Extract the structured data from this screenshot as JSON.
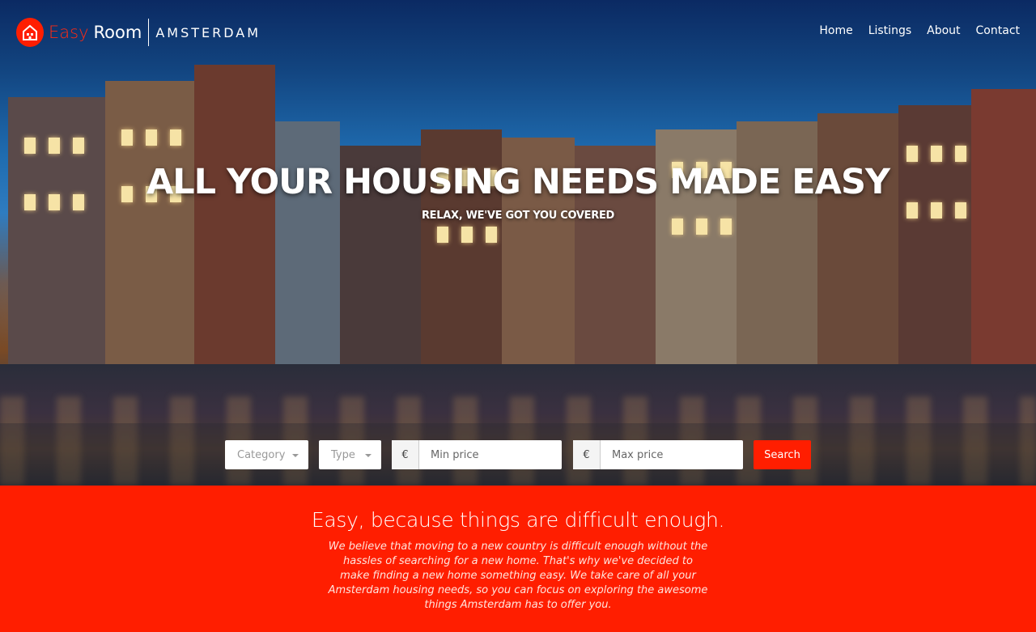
{
  "brand": {
    "easy": "Easy",
    "room": "Room",
    "city": "AMSTERDAM",
    "accent_color": "#ff1e00",
    "icon": "house-icon"
  },
  "nav": {
    "items": [
      {
        "label": "Home"
      },
      {
        "label": "Listings"
      },
      {
        "label": "About"
      },
      {
        "label": "Contact"
      }
    ]
  },
  "hero": {
    "headline": "ALL YOUR HOUSING NEEDS MADE EASY",
    "subhead": "RELAX, WE'VE GOT YOU COVERED"
  },
  "search": {
    "category_placeholder": "Category",
    "type_placeholder": "Type",
    "currency_symbol": "€",
    "min_price_placeholder": "Min price",
    "max_price_placeholder": "Max price",
    "button_label": "Search"
  },
  "about": {
    "title": "Easy, because things are difficult enough.",
    "body": "We believe that moving to a new country is difficult enough without the hassles of searching for a new home. That's why we've decided to make finding a new home something easy. We take care of all your Amsterdam housing needs, so you can focus on exploring the awesome things Amsterdam has to offer you."
  }
}
